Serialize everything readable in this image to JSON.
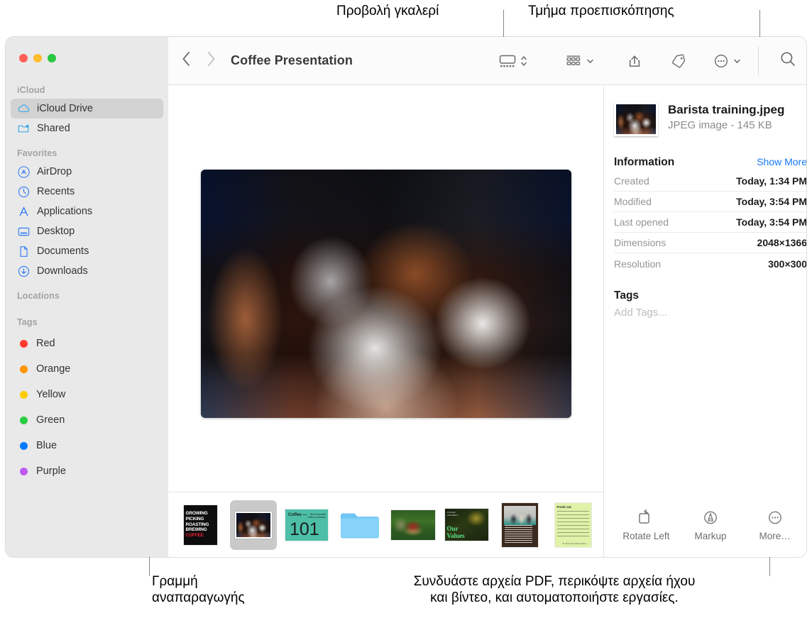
{
  "callouts": {
    "gallery_view": "Προβολή γκαλερί",
    "preview_pane": "Τμήμα προεπισκόπησης",
    "playback_bar": "Γραμμή\nαναπαραγωγής",
    "bottom_right": "Συνδυάστε αρχεία PDF, περικόψτε αρχεία ήχου\nκαι βίντεο, και αυτοματοποιήστε εργασίες."
  },
  "window": {
    "title": "Coffee Presentation",
    "traffic_lights": [
      "close",
      "minimize",
      "zoom"
    ]
  },
  "toolbar": {
    "back_label": "‹",
    "forward_label": "›",
    "view_gallery_label": "gallery-view",
    "group_label": "group-by",
    "share_label": "share",
    "tag_label": "tags",
    "more_label": "more-actions",
    "search_label": "search"
  },
  "sidebar": {
    "sections": [
      {
        "header": "iCloud",
        "items": [
          {
            "label": "iCloud Drive",
            "icon": "cloud-icon",
            "selected": true
          },
          {
            "label": "Shared",
            "icon": "shared-folder-icon",
            "selected": false
          }
        ]
      },
      {
        "header": "Favorites",
        "items": [
          {
            "label": "AirDrop",
            "icon": "airdrop-icon",
            "selected": false
          },
          {
            "label": "Recents",
            "icon": "clock-icon",
            "selected": false
          },
          {
            "label": "Applications",
            "icon": "applications-icon",
            "selected": false
          },
          {
            "label": "Desktop",
            "icon": "desktop-icon",
            "selected": false
          },
          {
            "label": "Documents",
            "icon": "document-icon",
            "selected": false
          },
          {
            "label": "Downloads",
            "icon": "downloads-icon",
            "selected": false
          }
        ]
      },
      {
        "header": "Locations",
        "items": []
      },
      {
        "header": "Tags",
        "items": [
          {
            "label": "Red",
            "color": "#ff3b30"
          },
          {
            "label": "Orange",
            "color": "#ff9500"
          },
          {
            "label": "Yellow",
            "color": "#ffcc00"
          },
          {
            "label": "Green",
            "color": "#28cd41"
          },
          {
            "label": "Blue",
            "color": "#007aff"
          },
          {
            "label": "Purple",
            "color": "#bf5af2"
          }
        ]
      }
    ]
  },
  "filmstrip": {
    "items": [
      {
        "name": "coffee-poster-thumbnail",
        "selected": false
      },
      {
        "name": "barista-training-thumbnail",
        "selected": true
      },
      {
        "name": "coffee-101-thumbnail",
        "selected": false
      },
      {
        "name": "folder-thumbnail",
        "selected": false
      },
      {
        "name": "berries-thumbnail",
        "selected": false
      },
      {
        "name": "our-values-thumbnail",
        "selected": false
      },
      {
        "name": "meeting-document-thumbnail",
        "selected": false
      },
      {
        "name": "receipt-thumbnail",
        "selected": false
      }
    ],
    "poster_lines": [
      "GROWING",
      "PICKING",
      "ROASTING",
      "BREWING",
      "COFFEE"
    ],
    "coffee101": {
      "number": "101",
      "label": "Coffee —",
      "note": "Brew essential\ncoffee production"
    },
    "values": {
      "line1": "Our",
      "line2": "Values",
      "kicker": "COFFEE\nGROWERS"
    },
    "receipt": {
      "title": "Fresh cut",
      "footer": "Its all in one with a lease !"
    }
  },
  "inspector": {
    "file_name": "Barista training.jpeg",
    "file_kind": "JPEG image - 145 KB",
    "information_title": "Information",
    "show_more": "Show More",
    "rows": [
      {
        "key": "Created",
        "value": "Today, 1:34 PM"
      },
      {
        "key": "Modified",
        "value": "Today, 3:54 PM"
      },
      {
        "key": "Last opened",
        "value": "Today, 3:54 PM"
      },
      {
        "key": "Dimensions",
        "value": "2048×1366"
      },
      {
        "key": "Resolution",
        "value": "300×300"
      }
    ],
    "tags_title": "Tags",
    "tags_placeholder": "Add Tags...",
    "actions": [
      {
        "label": "Rotate Left",
        "icon": "rotate-left-icon"
      },
      {
        "label": "Markup",
        "icon": "markup-icon"
      },
      {
        "label": "More…",
        "icon": "ellipsis-circle-icon"
      }
    ]
  },
  "colors": {
    "accent": "#1678f2",
    "sidebar_bg": "#e9e9e9",
    "selected_row": "#d2d2d2"
  }
}
